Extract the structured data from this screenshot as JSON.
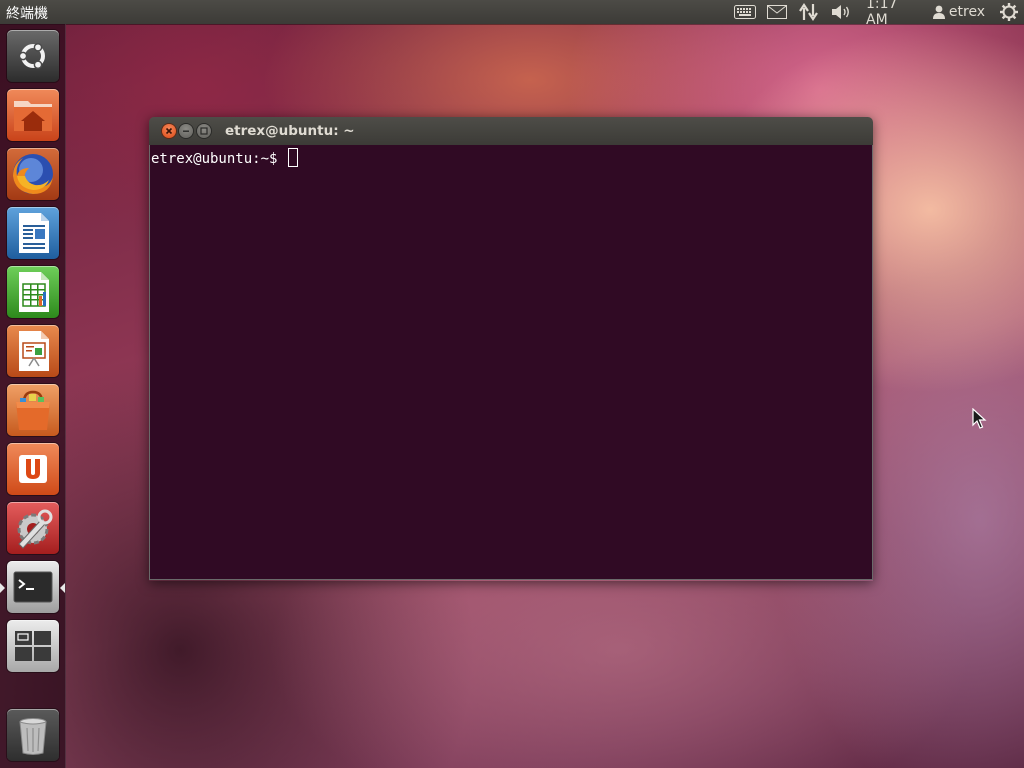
{
  "top_panel": {
    "app_name": "終端機",
    "icons": [
      "keyboard-icon",
      "mail-icon",
      "network-icon",
      "volume-icon",
      "power-icon"
    ],
    "clock": "1:17 AM",
    "user": "etrex"
  },
  "launcher": {
    "items": [
      {
        "name": "dash-home",
        "icon": "ubuntu-logo-icon"
      },
      {
        "name": "home-folder",
        "icon": "home-folder-icon"
      },
      {
        "name": "firefox",
        "icon": "firefox-icon"
      },
      {
        "name": "libreoffice-writer",
        "icon": "writer-icon"
      },
      {
        "name": "libreoffice-calc",
        "icon": "calc-icon"
      },
      {
        "name": "libreoffice-impress",
        "icon": "impress-icon"
      },
      {
        "name": "software-center",
        "icon": "software-center-icon"
      },
      {
        "name": "ubuntu-one",
        "icon": "ubuntu-one-icon"
      },
      {
        "name": "system-settings",
        "icon": "settings-icon"
      },
      {
        "name": "terminal",
        "icon": "terminal-icon",
        "active": true
      },
      {
        "name": "workspace-switcher",
        "icon": "workspace-icon"
      },
      {
        "name": "trash",
        "icon": "trash-icon"
      }
    ]
  },
  "terminal": {
    "title": "etrex@ubuntu: ~",
    "prompt": "etrex@ubuntu:~$ "
  },
  "colors": {
    "panel": "#3c3b37",
    "terminal_bg": "#300a24",
    "ubuntu_orange": "#dd4814"
  }
}
